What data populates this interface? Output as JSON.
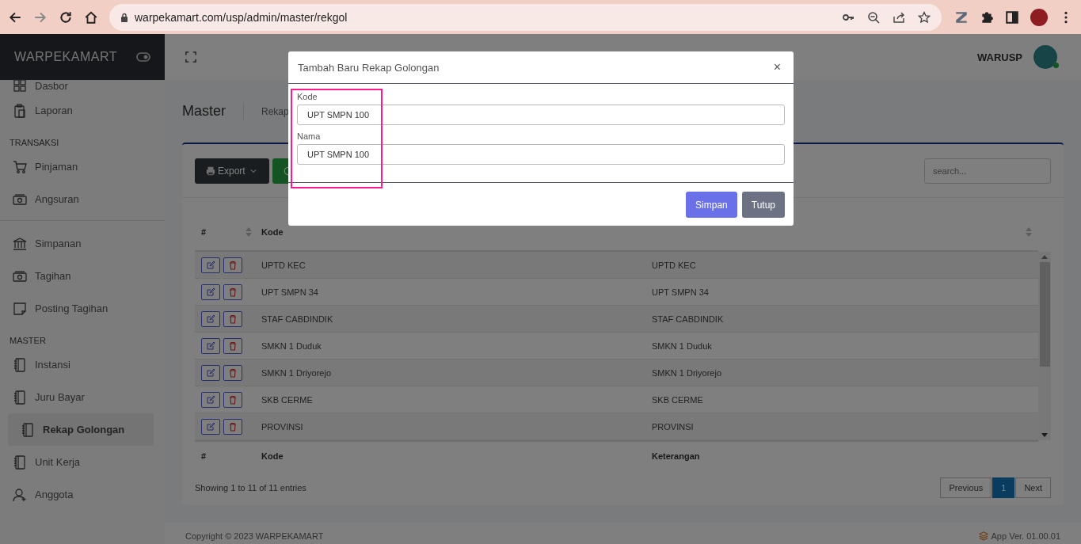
{
  "browser": {
    "url": "warpekamart.com/usp/admin/master/rekgol"
  },
  "sidebar": {
    "brand": "WARPEKAMART",
    "groups": [
      {
        "items": [
          {
            "label": "Dasbor",
            "kind": "grid",
            "selected": false
          },
          {
            "label": "Laporan",
            "kind": "clipboard",
            "selected": false
          }
        ]
      },
      {
        "title": "TRANSAKSI",
        "items": [
          {
            "label": "Pinjaman",
            "kind": "cart",
            "selected": false
          },
          {
            "label": "Angsuran",
            "kind": "cash",
            "selected": false
          }
        ]
      },
      {
        "items": [
          {
            "label": "Simpanan",
            "kind": "bank",
            "selected": false
          },
          {
            "label": "Tagihan",
            "kind": "cash",
            "selected": false
          },
          {
            "label": "Posting Tagihan",
            "kind": "note",
            "selected": false
          }
        ]
      },
      {
        "title": "MASTER",
        "items": [
          {
            "label": "Instansi",
            "kind": "book",
            "selected": false
          },
          {
            "label": "Juru Bayar",
            "kind": "book",
            "selected": false
          },
          {
            "label": "Rekap Golongan",
            "kind": "book",
            "selected": true
          },
          {
            "label": "Unit Kerja",
            "kind": "book",
            "selected": false
          },
          {
            "label": "Anggota",
            "kind": "user",
            "selected": false
          }
        ]
      }
    ]
  },
  "topbar": {
    "user": "WARUSP"
  },
  "page": {
    "title": "Master",
    "breadcrumb": "Rekap"
  },
  "toolbar": {
    "export_label": "Export",
    "search_placeholder": "search..."
  },
  "table": {
    "header": [
      "#",
      "Kode"
    ],
    "footer": [
      "#",
      "Kode",
      "Keterangan"
    ],
    "rows": [
      {
        "kode": "UPTD KEC",
        "keterangan": "UPTD KEC"
      },
      {
        "kode": "UPT SMPN 34",
        "keterangan": "UPT SMPN 34"
      },
      {
        "kode": "STAF CABDINDIK",
        "keterangan": "STAF CABDINDIK"
      },
      {
        "kode": "SMKN 1 Duduk",
        "keterangan": "SMKN 1 Duduk"
      },
      {
        "kode": "SMKN 1 Driyorejo",
        "keterangan": "SMKN 1 Driyorejo"
      },
      {
        "kode": "SKB CERME",
        "keterangan": "SKB CERME"
      },
      {
        "kode": "PROVINSI",
        "keterangan": "PROVINSI"
      }
    ],
    "info": "Showing 1 to 11 of 11 entries",
    "pagination": [
      {
        "label": "Previous",
        "selected": false
      },
      {
        "label": "1",
        "selected": true
      },
      {
        "label": "Next",
        "selected": false
      }
    ]
  },
  "footer": {
    "copyright": "Copyright © 2023 WARPEKAMART",
    "version": "App Ver. 01.00.01"
  },
  "modal": {
    "title": "Tambah Baru Rekap Golongan",
    "close": "×",
    "fields": [
      {
        "label": "Kode",
        "value": "UPT SMPN 100"
      },
      {
        "label": "Nama",
        "value": "UPT SMPN 100"
      }
    ],
    "buttons": [
      {
        "label": "Simpan",
        "kind": "primary"
      },
      {
        "label": "Tutup",
        "kind": "secondary"
      }
    ]
  }
}
